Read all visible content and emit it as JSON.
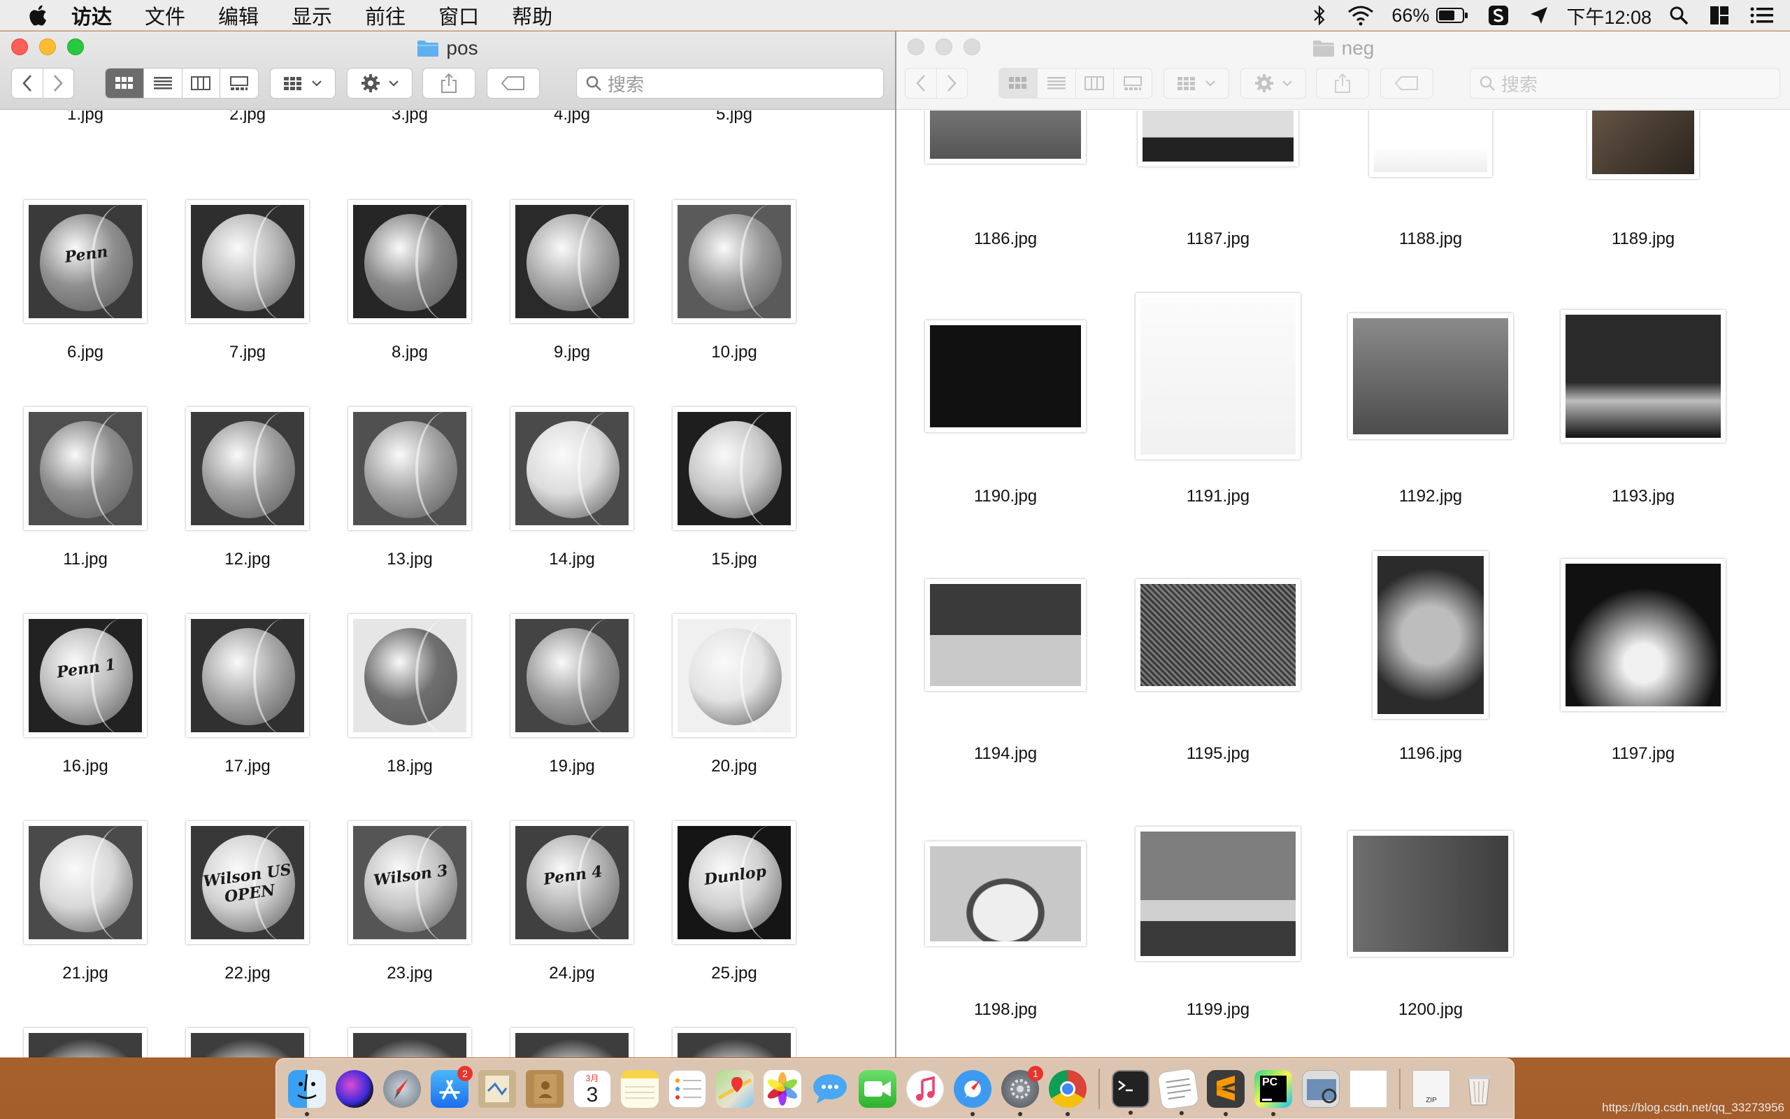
{
  "menubar": {
    "items": [
      "访达",
      "文件",
      "编辑",
      "显示",
      "前往",
      "窗口",
      "帮助"
    ],
    "battery": "66%",
    "clock": "下午12:08"
  },
  "win_pos": {
    "title": "pos",
    "search_placeholder": "搜索",
    "partial_row_labels": [
      "1.jpg",
      "2.jpg",
      "3.jpg",
      "4.jpg",
      "5.jpg"
    ],
    "rows": [
      [
        "6.jpg",
        "7.jpg",
        "8.jpg",
        "9.jpg",
        "10.jpg"
      ],
      [
        "11.jpg",
        "12.jpg",
        "13.jpg",
        "14.jpg",
        "15.jpg"
      ],
      [
        "16.jpg",
        "17.jpg",
        "18.jpg",
        "19.jpg",
        "20.jpg"
      ],
      [
        "21.jpg",
        "22.jpg",
        "23.jpg",
        "24.jpg",
        "25.jpg"
      ]
    ],
    "ball_prints": [
      "Penn",
      "",
      "",
      "",
      "",
      "",
      "",
      "",
      "",
      "",
      "Penn 1",
      "",
      "",
      "",
      "",
      "",
      "Wilson US OPEN",
      "Wilson 3",
      "Penn 4",
      "Dunlop"
    ]
  },
  "win_neg": {
    "title": "neg",
    "search_placeholder": "搜索",
    "rows": [
      [
        "1186.jpg",
        "1187.jpg",
        "1188.jpg",
        "1189.jpg"
      ],
      [
        "1190.jpg",
        "1191.jpg",
        "1192.jpg",
        "1193.jpg"
      ],
      [
        "1194.jpg",
        "1195.jpg",
        "1196.jpg",
        "1197.jpg"
      ],
      [
        "1198.jpg",
        "1199.jpg",
        "1200.jpg"
      ]
    ]
  },
  "dock": {
    "app_store_badge": "2",
    "calendar_month": "3月",
    "calendar_day": "3",
    "prefs_badge": "1",
    "pycharm_label": "PC",
    "zip_label": "ZIP"
  },
  "watermark": "https://blog.csdn.net/qq_33273956",
  "colors": {
    "close": "#fe5f57",
    "minimize": "#febc2e",
    "zoom": "#28c840",
    "folder_blue": "#5fb0f0"
  }
}
